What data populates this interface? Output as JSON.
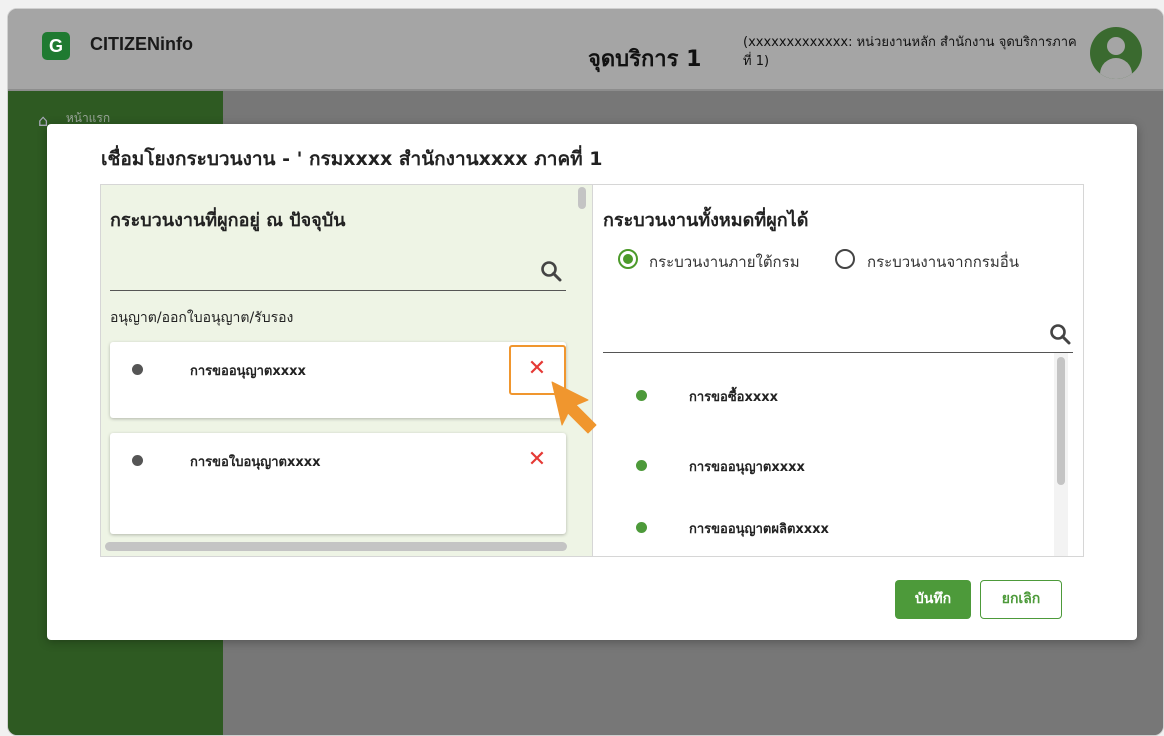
{
  "app": {
    "logo_letter": "G",
    "brand": "CITIZENinfo",
    "service_title": "จุดบริการ 1",
    "service_subtitle": "(xxxxxxxxxxxxx: หน่วยงานหลัก สำนักงาน จุดบริการภาคที่ 1)"
  },
  "sidebar": {
    "home_label": "หน้าแรก"
  },
  "modal": {
    "title": "เชื่อมโยงกระบวนงาน - ' กรมxxxx สำนักงานxxxx ภาคที่ 1",
    "left": {
      "heading": "กระบวนงานที่ผูกอยู่ ณ ปัจจุบัน",
      "group_label": "อนุญาต/ออกใบอนุญาต/รับรอง",
      "items": [
        {
          "label": "การขออนุญาตxxxx",
          "remove": "✕"
        },
        {
          "label": "การขอใบอนุญาตxxxx",
          "remove": "✕"
        }
      ]
    },
    "right": {
      "heading": "กระบวนงานทั้งหมดที่ผูกได้",
      "radio_options": [
        {
          "label": "กระบวนงานภายใต้กรม",
          "selected": true
        },
        {
          "label": "กระบวนงานจากกรมอื่น",
          "selected": false
        }
      ],
      "items": [
        {
          "label": "การขอซื้อxxxx"
        },
        {
          "label": "การขออนุญาตxxxx"
        },
        {
          "label": "การขออนุญาตผลิตxxxx"
        }
      ]
    },
    "save_label": "บันทึก",
    "cancel_label": "ยกเลิก"
  },
  "colors": {
    "accent_green": "#4d9a3a",
    "remove_red": "#e53935",
    "highlight_orange": "#f0962e"
  }
}
